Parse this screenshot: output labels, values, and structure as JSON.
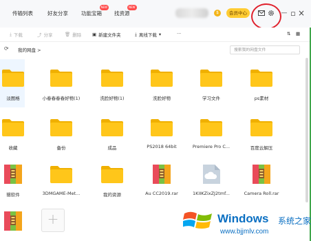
{
  "nav": {
    "items": [
      "传输列表",
      "好友分享",
      "功能宝箱",
      "找资源"
    ],
    "badge": "NEW"
  },
  "account": {
    "vip_label": "会员中心",
    "coin_glyph": "$"
  },
  "window": {
    "minimize": "—",
    "restore": "▫",
    "close": "×"
  },
  "toolbar": {
    "download": "下载",
    "share": "分享",
    "delete": "删除",
    "new_folder": "新建文件夹",
    "offline": "离线下载",
    "more": "···"
  },
  "address": {
    "refresh": "⟳",
    "breadcrumb": "我的网盘  >",
    "search_placeholder": "搜索我的网盘文件"
  },
  "files": [
    {
      "label": "淡图格",
      "type": "folder"
    },
    {
      "label": "小春春春春好物(1)",
      "type": "folder"
    },
    {
      "label": "洗脸好物(1)",
      "type": "folder"
    },
    {
      "label": "洗脸好物",
      "type": "folder"
    },
    {
      "label": "学习文件",
      "type": "folder"
    },
    {
      "label": "ps素材",
      "type": "folder"
    },
    {
      "label": "收藏",
      "type": "folder"
    },
    {
      "label": "备份",
      "type": "folder"
    },
    {
      "label": "成品",
      "type": "folder"
    },
    {
      "label": "PS2018 64bit",
      "type": "folder"
    },
    {
      "label": "Premiere Pro C...",
      "type": "folder"
    },
    {
      "label": "百度云解压",
      "type": "folder"
    },
    {
      "label": "辑软件",
      "type": "archive"
    },
    {
      "label": "3DMGAME-Met...",
      "type": "folder"
    },
    {
      "label": "我的资源",
      "type": "folder"
    },
    {
      "label": "Au CC2019.rar",
      "type": "archive"
    },
    {
      "label": "1KIIKZixZJ2tmf...",
      "type": "cloud"
    },
    {
      "label": "Camera Roll.rar",
      "type": "archive"
    },
    {
      "label": "",
      "type": "archive"
    }
  ],
  "add_tile": {
    "glyph": "+"
  },
  "watermark": {
    "title": "Windows",
    "cn": "系统之家",
    "url": "www.bjjmlv.com"
  },
  "colors": {
    "folder": "#ffc61a",
    "folder_tab": "#f0b000",
    "brand": "#0a6fc2",
    "annotation": "#e0202c"
  }
}
